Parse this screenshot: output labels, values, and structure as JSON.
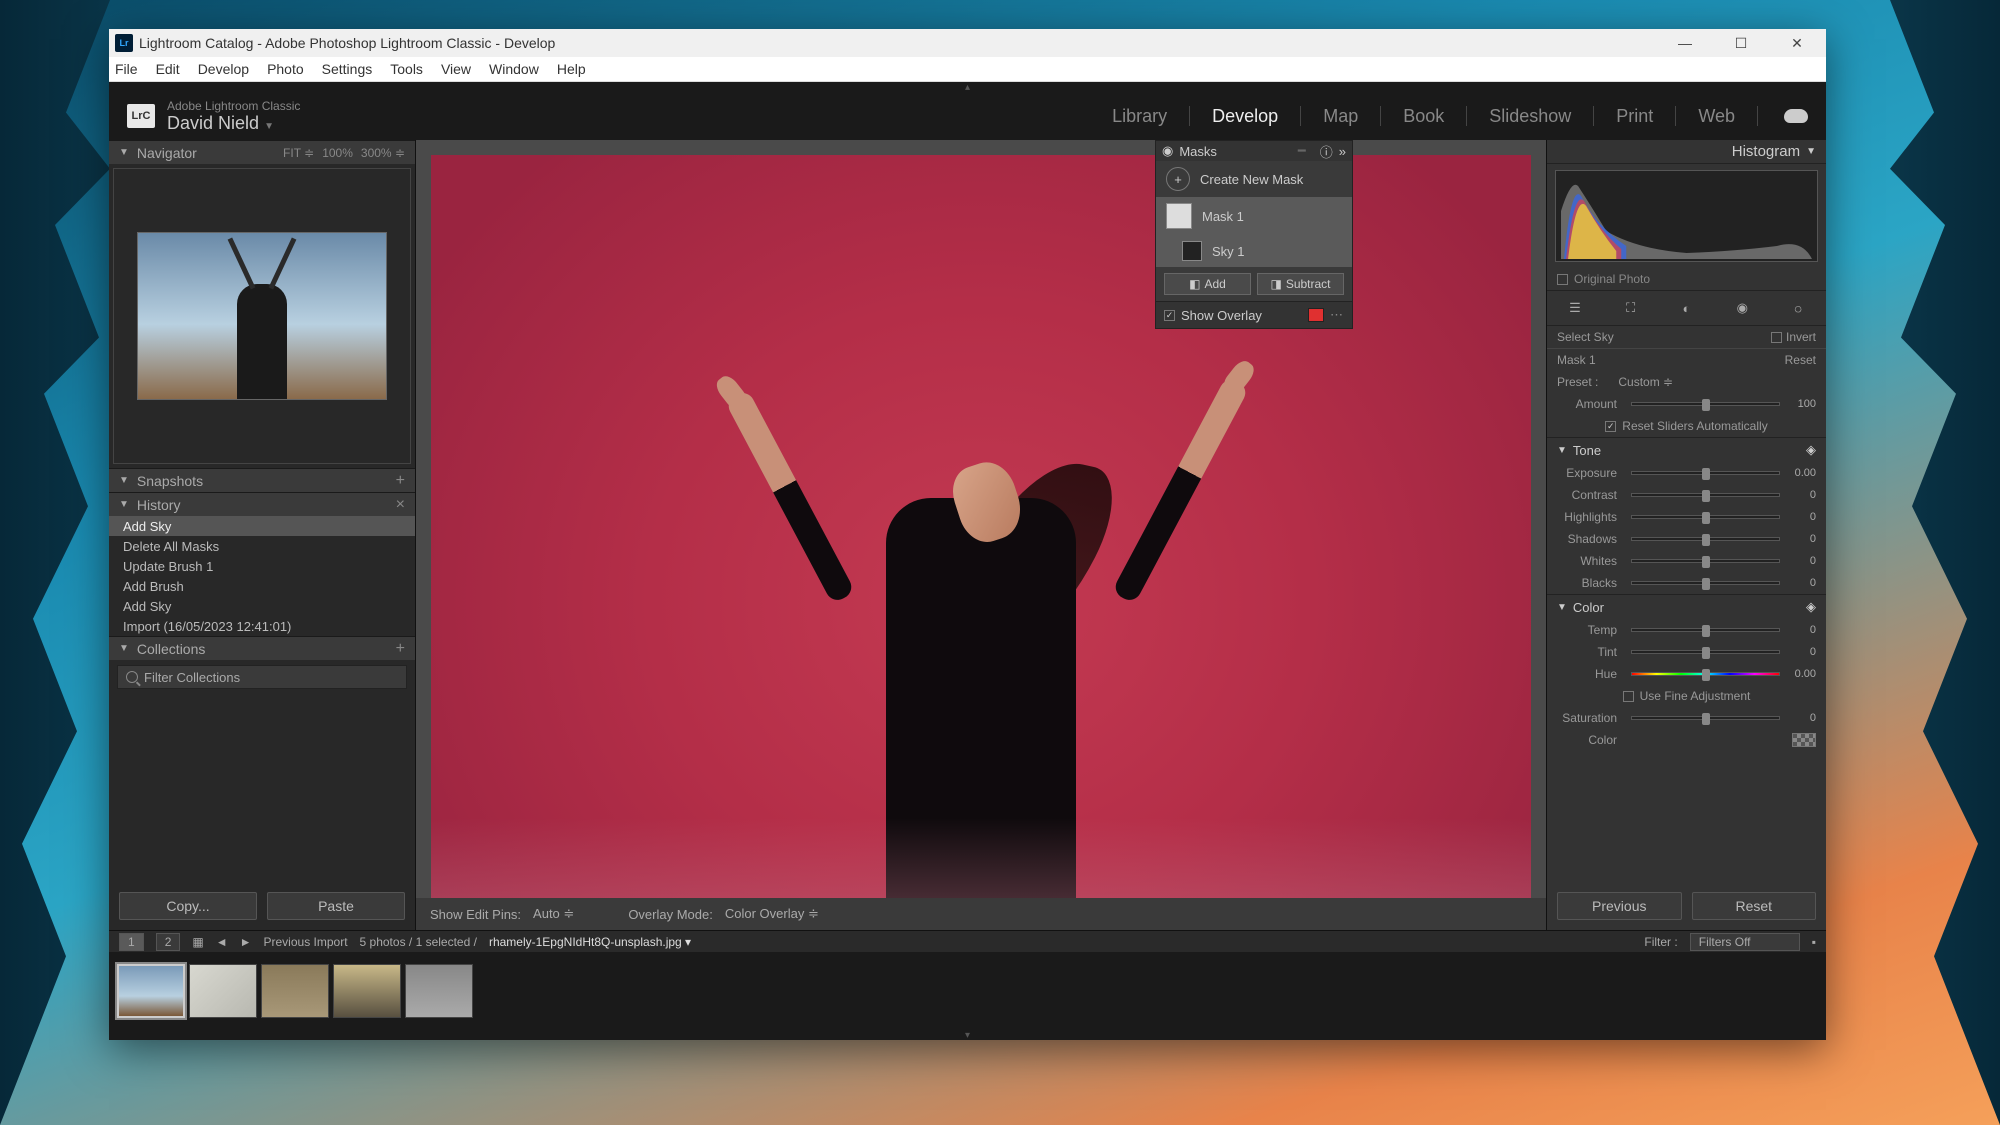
{
  "titlebar": {
    "icon_text": "Lr",
    "title": "Lightroom Catalog - Adobe Photoshop Lightroom Classic - Develop"
  },
  "menubar": [
    "File",
    "Edit",
    "Develop",
    "Photo",
    "Settings",
    "Tools",
    "View",
    "Window",
    "Help"
  ],
  "identity": {
    "product": "Adobe Lightroom Classic",
    "user": "David Nield"
  },
  "modules": [
    "Library",
    "Develop",
    "Map",
    "Book",
    "Slideshow",
    "Print",
    "Web"
  ],
  "active_module": "Develop",
  "left": {
    "navigator": {
      "title": "Navigator",
      "zoom_fit": "FIT",
      "zoom_100": "100%",
      "zoom_300": "300%"
    },
    "snapshots": {
      "title": "Snapshots"
    },
    "history": {
      "title": "History",
      "items": [
        "Add Sky",
        "Delete All Masks",
        "Update Brush 1",
        "Add Brush",
        "Add Sky",
        "Import (16/05/2023 12:41:01)"
      ],
      "selected": 0
    },
    "collections": {
      "title": "Collections",
      "filter_placeholder": "Filter Collections"
    },
    "copy_btn": "Copy...",
    "paste_btn": "Paste"
  },
  "center_toolbar": {
    "edit_pins_label": "Show Edit Pins:",
    "edit_pins_value": "Auto",
    "overlay_mode_label": "Overlay Mode:",
    "overlay_mode_value": "Color Overlay"
  },
  "masks": {
    "title": "Masks",
    "create": "Create New Mask",
    "items": [
      {
        "name": "Mask 1"
      },
      {
        "name": "Sky 1"
      }
    ],
    "add_btn": "Add",
    "subtract_btn": "Subtract",
    "show_overlay": "Show Overlay"
  },
  "right": {
    "histogram_title": "Histogram",
    "original_photo": "Original Photo",
    "select_sky": "Select Sky",
    "invert": "Invert",
    "mask_name": "Mask 1",
    "reset": "Reset",
    "preset_label": "Preset :",
    "preset_value": "Custom",
    "amount_label": "Amount",
    "amount_value": "100",
    "reset_auto": "Reset Sliders Automatically",
    "tone": {
      "title": "Tone",
      "sliders": [
        {
          "label": "Exposure",
          "value": "0.00"
        },
        {
          "label": "Contrast",
          "value": "0"
        },
        {
          "label": "Highlights",
          "value": "0"
        },
        {
          "label": "Shadows",
          "value": "0"
        },
        {
          "label": "Whites",
          "value": "0"
        },
        {
          "label": "Blacks",
          "value": "0"
        }
      ]
    },
    "color": {
      "title": "Color",
      "sliders": [
        {
          "label": "Temp",
          "value": "0"
        },
        {
          "label": "Tint",
          "value": "0"
        },
        {
          "label": "Hue",
          "value": "0.00"
        }
      ],
      "fine_adjust": "Use Fine Adjustment",
      "saturation": {
        "label": "Saturation",
        "value": "0"
      },
      "color_label": "Color"
    },
    "previous_btn": "Previous",
    "reset_btn": "Reset"
  },
  "filmstrip": {
    "view1": "1",
    "view2": "2",
    "collection": "Previous Import",
    "count": "5 photos / 1 selected /",
    "filename": "rhamely-1EpgNIdHt8Q-unsplash.jpg",
    "filter_label": "Filter :",
    "filter_value": "Filters Off"
  }
}
